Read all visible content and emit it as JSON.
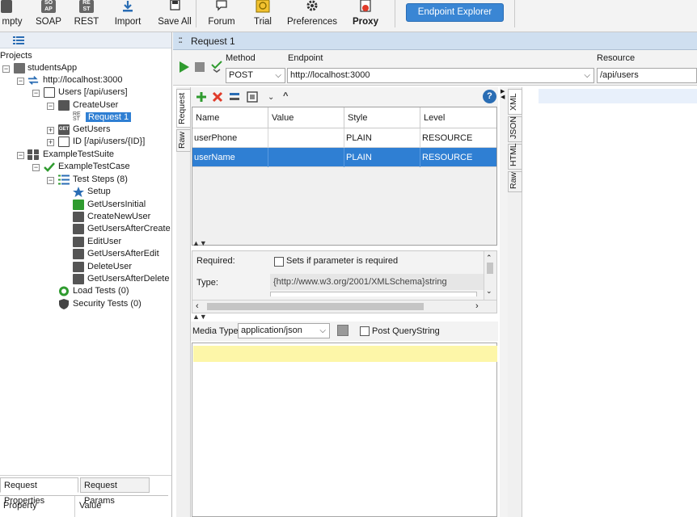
{
  "toolbar": {
    "buttons": [
      {
        "label": "mpty"
      },
      {
        "label": "SOAP"
      },
      {
        "label": "REST"
      },
      {
        "label": "Import"
      },
      {
        "label": "Save All"
      },
      {
        "label": "Forum"
      },
      {
        "label": "Trial"
      },
      {
        "label": "Preferences"
      },
      {
        "label": "Proxy"
      }
    ],
    "endpoint_explorer": "Endpoint Explorer",
    "icon_text": {
      "soap": "SO AP",
      "rest": "RE ST"
    }
  },
  "navigator": {
    "header": "Projects",
    "tree": [
      {
        "label": "studentsApp"
      },
      {
        "label": "http://localhost:3000"
      },
      {
        "label": "Users [/api/users]"
      },
      {
        "label": "CreateUser"
      },
      {
        "label": "Request 1"
      },
      {
        "label": "GetUsers"
      },
      {
        "label": "ID [/api/users/{ID}]"
      },
      {
        "label": "ExampleTestSuite"
      },
      {
        "label": "ExampleTestCase"
      },
      {
        "label": "Test Steps (8)"
      },
      {
        "label": "Setup"
      },
      {
        "label": "GetUsersInitial"
      },
      {
        "label": "CreateNewUser"
      },
      {
        "label": "GetUsersAfterCreate"
      },
      {
        "label": "EditUser"
      },
      {
        "label": "GetUsersAfterEdit"
      },
      {
        "label": "DeleteUser"
      },
      {
        "label": "GetUsersAfterDelete"
      },
      {
        "label": "Load Tests (0)"
      },
      {
        "label": "Security Tests (0)"
      }
    ],
    "get_icon_text": "GET",
    "bottom_tabs": [
      "Request Properties",
      "Request Params"
    ],
    "prop_headers": [
      "Property",
      "Value"
    ]
  },
  "request": {
    "title": "Request 1",
    "labels": {
      "method": "Method",
      "endpoint": "Endpoint",
      "resource": "Resource"
    },
    "method": "POST",
    "endpoint": "http://localhost:3000",
    "resource": "/api/users",
    "left_tabs": [
      "Request",
      "Raw"
    ],
    "right_tabs": [
      "XML",
      "JSON",
      "HTML",
      "Raw"
    ],
    "params": {
      "headers": [
        "Name",
        "Value",
        "Style",
        "Level"
      ],
      "rows": [
        {
          "name": "userPhone",
          "value": "",
          "style": "PLAIN",
          "level": "RESOURCE"
        },
        {
          "name": "userName",
          "value": "",
          "style": "PLAIN",
          "level": "RESOURCE"
        }
      ]
    },
    "detail": {
      "required_label": "Required:",
      "required_checkbox": "Sets if parameter is required",
      "type_label": "Type:",
      "type_value": "{http://www.w3.org/2001/XMLSchema}string"
    },
    "media": {
      "label": "Media Type",
      "value": "application/json",
      "post_query": "Post QueryString"
    },
    "help_icon_text": "?"
  }
}
